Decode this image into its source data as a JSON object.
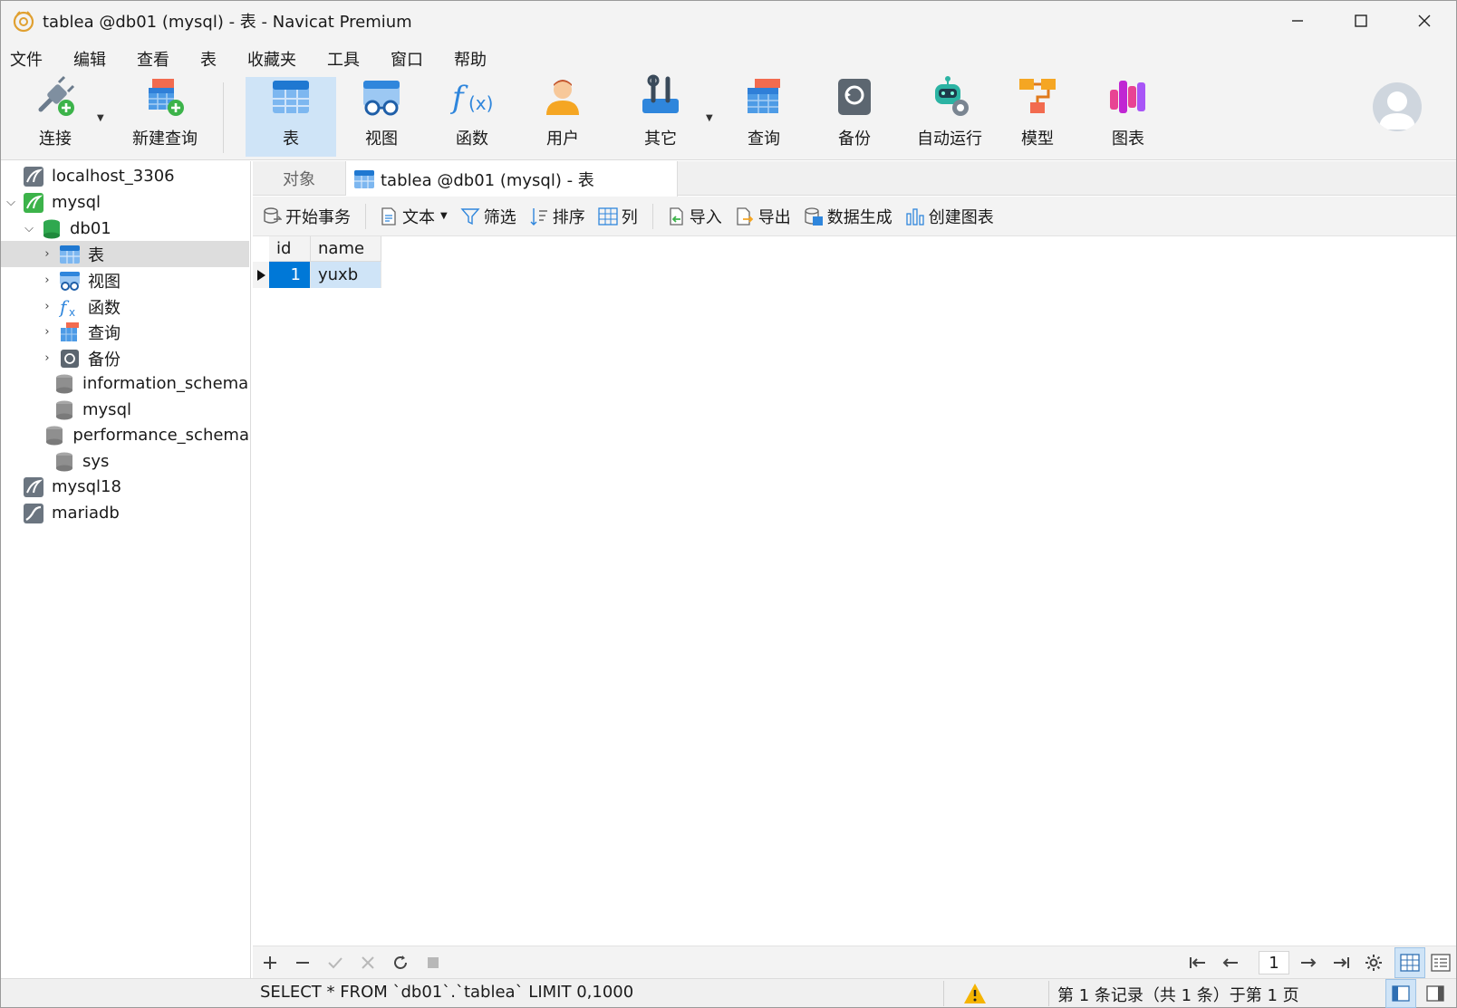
{
  "window": {
    "title": "tablea @db01 (mysql) - 表 - Navicat Premium"
  },
  "menu": [
    "文件",
    "编辑",
    "查看",
    "表",
    "收藏夹",
    "工具",
    "窗口",
    "帮助"
  ],
  "toolbar": {
    "connect": "连接",
    "new_query": "新建查询",
    "table": "表",
    "view": "视图",
    "function": "函数",
    "user": "用户",
    "other": "其它",
    "query": "查询",
    "backup": "备份",
    "automation": "自动运行",
    "model": "模型",
    "chart": "图表"
  },
  "tree": {
    "conn1": "localhost_3306",
    "conn2": "mysql",
    "db": "db01",
    "tables": "表",
    "views": "视图",
    "functions": "函数",
    "queries": "查询",
    "backups": "备份",
    "db_info": "information_schema",
    "db_mysql": "mysql",
    "db_perf": "performance_schema",
    "db_sys": "sys",
    "conn3": "mysql18",
    "conn4": "mariadb"
  },
  "tabs": {
    "objects": "对象",
    "active": "tablea @db01 (mysql) - 表"
  },
  "subtoolbar": {
    "begin_tx": "开始事务",
    "text": "文本",
    "filter": "筛选",
    "sort": "排序",
    "columns": "列",
    "import": "导入",
    "export": "导出",
    "datagen": "数据生成",
    "create_chart": "创建图表"
  },
  "grid": {
    "columns": [
      "id",
      "name"
    ],
    "rows": [
      [
        "1",
        "yuxb"
      ]
    ]
  },
  "pager": {
    "page": "1"
  },
  "status": {
    "sql": "SELECT * FROM `db01`.`tablea` LIMIT 0,1000",
    "records": "第 1 条记录（共 1 条）于第 1 页"
  },
  "colors": {
    "accent": "#0078d7",
    "selection": "#cfe4f7",
    "chrome": "#f3f3f3"
  }
}
